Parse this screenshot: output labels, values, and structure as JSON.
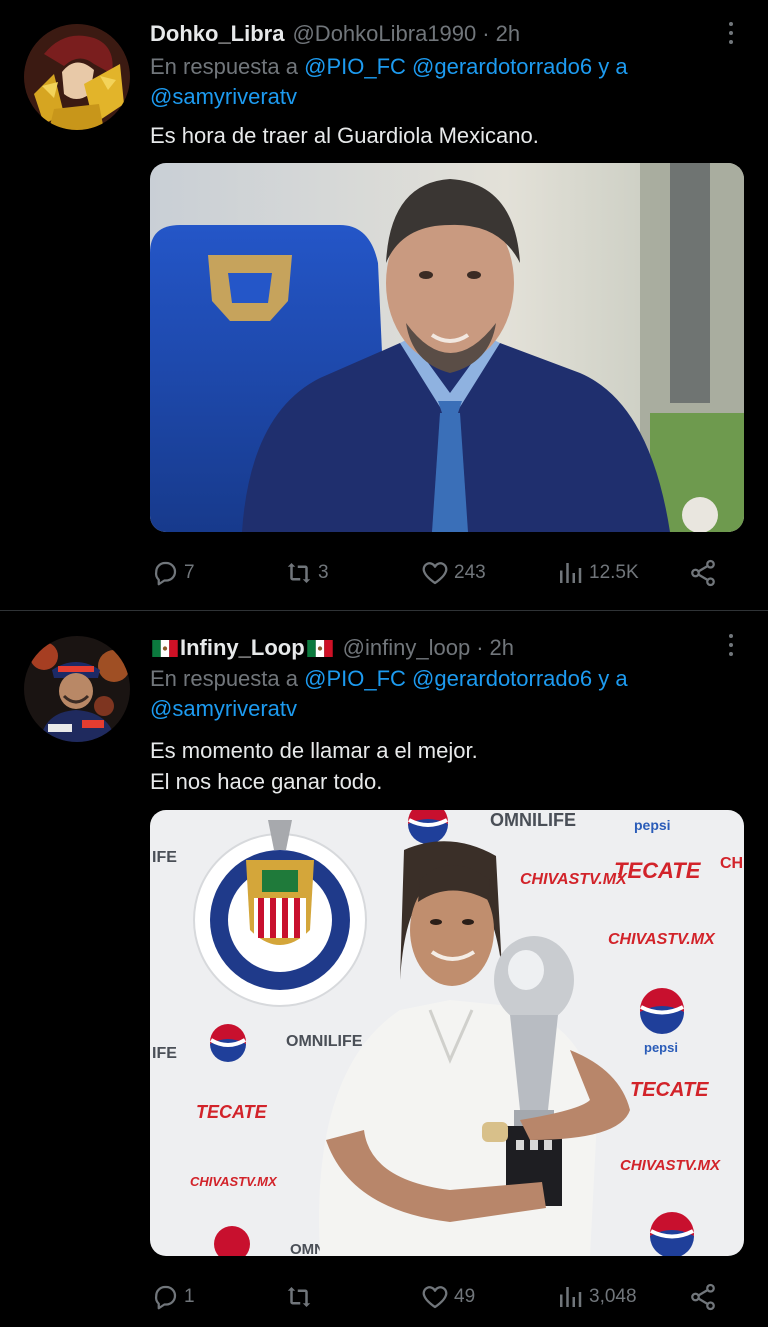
{
  "tweets": [
    {
      "display_name": "Dohko_Libra",
      "handle": "@DohkoLibra1990",
      "separator": "·",
      "time": "2h",
      "reply_prefix": "En respuesta a",
      "reply_mentions_line1": "@PIO_FC @gerardotorrado6 y a",
      "reply_mentions_line2": "@samyriveratv",
      "text_lines": [
        "Es hora de traer al Guardiola Mexicano."
      ],
      "media_desc": "photo-smiling-man-in-suit",
      "stats": {
        "replies": "7",
        "retweets": "3",
        "likes": "243",
        "views": "12.5K"
      }
    },
    {
      "display_name": "Infiny_Loop",
      "name_flag": "mexico-flag-icon",
      "handle": "@infiny_loop",
      "separator": "·",
      "time": "2h",
      "reply_prefix": "En respuesta a",
      "reply_mentions_line1": "@PIO_FC @gerardotorrado6 y a",
      "reply_mentions_line2": "@samyriveratv",
      "text_lines": [
        "Es momento de llamar a el mejor.",
        "El nos hace ganar todo."
      ],
      "media_desc": "photo-man-holding-trophy",
      "sponsor_board": [
        "OMNILIFE",
        "pepsi",
        "TECATE",
        "CHIVASTV.MX",
        "IFE",
        "CH"
      ],
      "stats": {
        "replies": "1",
        "retweets": "",
        "likes": "49",
        "views": "3,048"
      }
    }
  ],
  "colors": {
    "background": "#000000",
    "text": "#e7e9ea",
    "secondary": "#71767b",
    "link": "#1d9bf0",
    "divider": "#2f3336"
  }
}
